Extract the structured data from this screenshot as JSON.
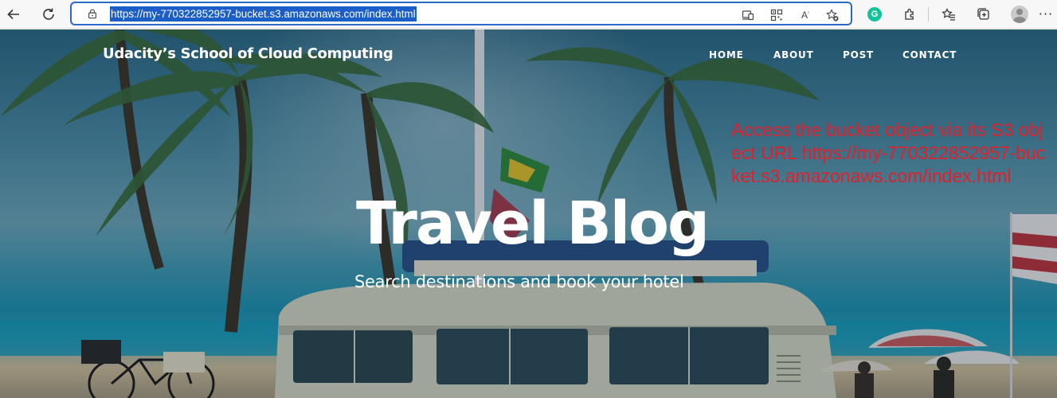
{
  "browser": {
    "url": "https://my-770322852957-bucket.s3.amazonaws.com/index.html",
    "read_aloud_label": "Aʾ",
    "more_label": "···",
    "grammarly_label": "G",
    "icons": [
      "back-icon",
      "refresh-icon",
      "lock-icon",
      "app-available-icon",
      "qr-code-icon",
      "read-aloud-icon",
      "add-favorite-icon",
      "grammarly-icon",
      "extensions-icon",
      "favorites-icon",
      "collections-icon",
      "profile-avatar",
      "more-icon"
    ]
  },
  "site": {
    "brand": "Udacity’s School of Cloud Computing",
    "nav": [
      "HOME",
      "ABOUT",
      "POST",
      "CONTACT"
    ],
    "title": "Travel Blog",
    "subtitle": "Search destinations and book your hotel"
  },
  "annotation": {
    "text": "Access the bucket object via its S3 object URL https://my-770322852957-bucket.s3.amazonaws.com/index.html",
    "color": "#e0202a"
  }
}
